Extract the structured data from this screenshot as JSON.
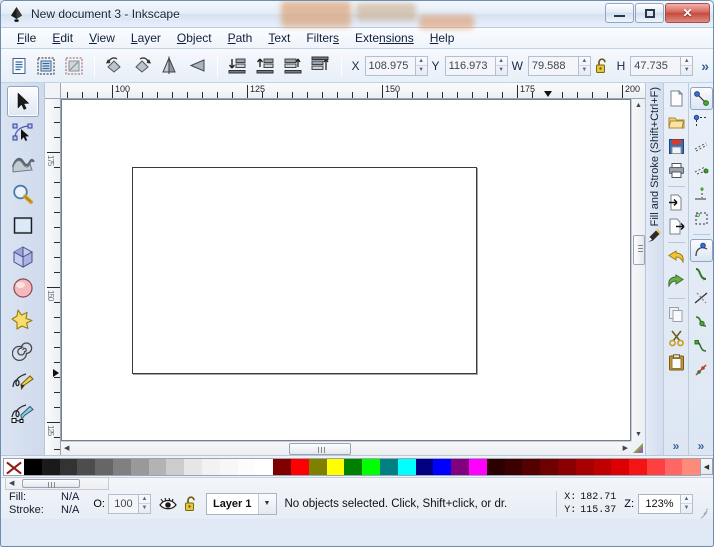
{
  "window": {
    "title": "New document 3 - Inkscape",
    "app_icon": "inkscape-logo-icon",
    "buttons": {
      "minimize": "minimize-button",
      "maximize": "maximize-button",
      "close": "✕"
    }
  },
  "menubar": {
    "items": [
      {
        "label": "File",
        "pre": "F",
        "mid": "ile"
      },
      {
        "label": "Edit",
        "pre": "E",
        "mid": "dit"
      },
      {
        "label": "View",
        "pre": "V",
        "mid": "iew"
      },
      {
        "label": "Layer",
        "pre": "L",
        "mid": "ayer"
      },
      {
        "label": "Object",
        "pre": "O",
        "mid": "bject"
      },
      {
        "label": "Path",
        "pre": "P",
        "mid": "ath"
      },
      {
        "label": "Text",
        "pre": "T",
        "mid": "ext"
      },
      {
        "label": "Filters",
        "pre": "Filter",
        "mid": "s"
      },
      {
        "label": "Extensions",
        "pre": "Exte",
        "mid": "nsions"
      },
      {
        "label": "Help",
        "pre": "H",
        "mid": "elp"
      }
    ]
  },
  "cmdbar": {
    "buttons": [
      {
        "name": "select-all-icon"
      },
      {
        "name": "select-all-in-all-layers-icon"
      },
      {
        "name": "deselect-icon"
      },
      {
        "name": "rotate-90-ccw-icon"
      },
      {
        "name": "rotate-90-cw-icon"
      },
      {
        "name": "flip-horizontal-icon"
      },
      {
        "name": "flip-vertical-icon"
      },
      {
        "name": "raise-to-top-icon"
      },
      {
        "name": "raise-icon"
      },
      {
        "name": "lower-icon"
      },
      {
        "name": "lower-to-bottom-icon"
      }
    ],
    "fields": [
      {
        "label": "X",
        "value": "108.975",
        "name": "x-field"
      },
      {
        "label": "Y",
        "value": "116.973",
        "name": "y-field"
      },
      {
        "label": "W",
        "value": "79.588",
        "name": "w-field"
      },
      {
        "label": "H",
        "value": "47.735",
        "name": "h-field"
      }
    ],
    "lock_icon": "lock-open-icon",
    "overflow": "»"
  },
  "toolbox": {
    "tools": [
      {
        "name": "selector-tool",
        "active": true
      },
      {
        "name": "node-editor-tool",
        "active": false
      },
      {
        "name": "tweak-tool",
        "active": false
      },
      {
        "name": "zoom-tool",
        "active": false
      },
      {
        "name": "rectangle-tool",
        "active": false
      },
      {
        "name": "3d-box-tool",
        "active": false
      },
      {
        "name": "ellipse-tool",
        "active": false
      },
      {
        "name": "star-tool",
        "active": false
      },
      {
        "name": "spiral-tool",
        "active": false
      },
      {
        "name": "pencil-tool",
        "active": false
      },
      {
        "name": "bezier-pen-tool",
        "active": false
      }
    ]
  },
  "rulers": {
    "h_labels": [
      "100",
      "125",
      "150",
      "175",
      "200"
    ],
    "v_labels": [
      "175",
      "150",
      "125"
    ],
    "units": "px"
  },
  "dock": {
    "fill_and_stroke_tab": "Fill and Stroke (Shift+Ctrl+F)",
    "fill_and_stroke_icon": "fill-stroke-icon"
  },
  "right_command_bar": {
    "buttons": [
      {
        "name": "new-document-icon"
      },
      {
        "name": "open-document-icon"
      },
      {
        "name": "save-document-icon"
      },
      {
        "name": "print-document-icon"
      },
      {
        "name": "import-icon"
      },
      {
        "name": "export-icon"
      },
      {
        "name": "undo-icon"
      },
      {
        "name": "redo-icon"
      },
      {
        "name": "copy-icon"
      },
      {
        "name": "cut-icon"
      },
      {
        "name": "paste-icon"
      }
    ],
    "overflow": "»"
  },
  "right_snap_bar": {
    "buttons": [
      {
        "name": "enable-snapping-icon",
        "active": true
      },
      {
        "name": "snap-bounding-box-icon",
        "active": false
      },
      {
        "name": "snap-bbox-edges-icon",
        "active": false
      },
      {
        "name": "snap-bbox-corners-icon",
        "active": false
      },
      {
        "name": "snap-bbox-edge-midpoints-icon",
        "active": false
      },
      {
        "name": "snap-bbox-centers-icon",
        "active": false
      },
      {
        "name": "snap-nodes-paths-icon",
        "active": true
      },
      {
        "name": "snap-paths-icon",
        "active": false
      },
      {
        "name": "snap-path-intersections-icon",
        "active": false
      },
      {
        "name": "snap-to-cusp-nodes-icon",
        "active": false
      },
      {
        "name": "snap-to-smooth-nodes-icon",
        "active": false
      },
      {
        "name": "snap-midpoints-icon",
        "active": false
      }
    ],
    "overflow": "»"
  },
  "palette": {
    "none_swatch": "no-color-swatch",
    "colors": [
      "#000000",
      "#1a1a1a",
      "#333333",
      "#4d4d4d",
      "#666666",
      "#808080",
      "#999999",
      "#b3b3b3",
      "#cccccc",
      "#e6e6e6",
      "#f2f2f2",
      "#f7f7f7",
      "#fcfcfc",
      "#ffffff",
      "#800000",
      "#ff0000",
      "#808000",
      "#ffff00",
      "#008000",
      "#00ff00",
      "#008080",
      "#00ffff",
      "#000080",
      "#0000ff",
      "#800080",
      "#ff00ff",
      "#2b0000",
      "#3d0000",
      "#550000",
      "#6e0000",
      "#8a0000",
      "#a60000",
      "#c00000",
      "#dd0000",
      "#f51414",
      "#ff4040",
      "#ff6666",
      "#ff8a7a"
    ],
    "scroll_arrow": "◀"
  },
  "statusbar": {
    "fill_label": "Fill:",
    "fill_value": "N/A",
    "stroke_label": "Stroke:",
    "stroke_value": "N/A",
    "opacity_label": "O:",
    "opacity_value": "100",
    "visibility_icon": "eye-icon",
    "lock_icon": "lock-open-icon",
    "layer_name": "Layer 1",
    "layer_dropdown_arrow": "▼",
    "message": "No objects selected. Click, Shift+click, or dr.",
    "coord_x_label": "X:",
    "coord_x": "182.71",
    "coord_y_label": "Y:",
    "coord_y": "115.37",
    "zoom_label": "Z:",
    "zoom_value": "123%"
  }
}
